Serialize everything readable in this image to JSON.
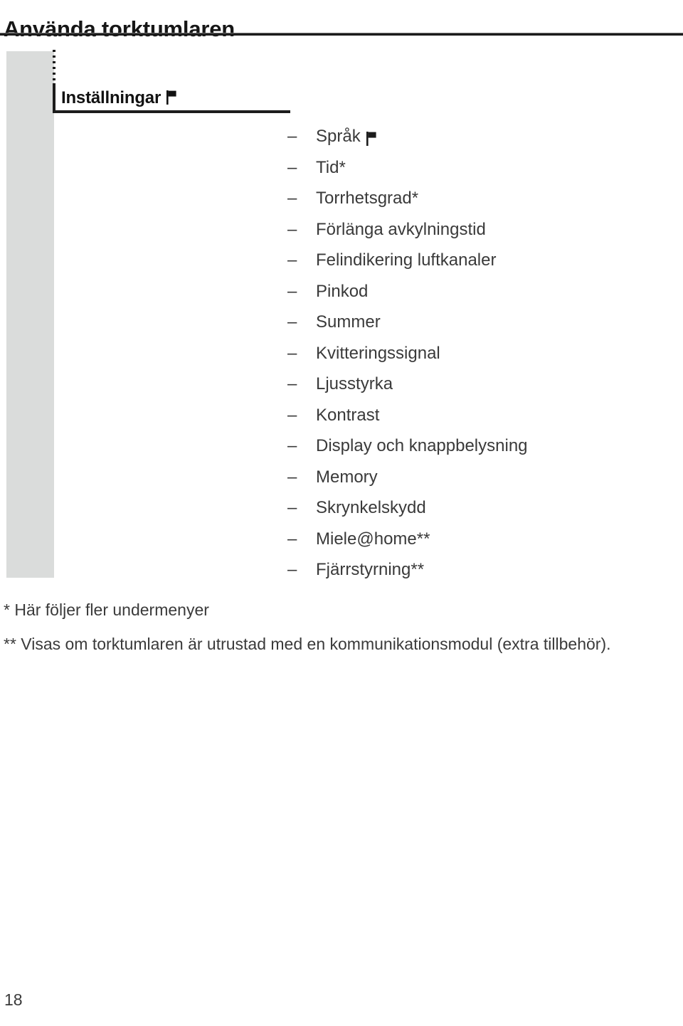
{
  "document": {
    "title": "Använda torktumlaren",
    "page_number": "18"
  },
  "menu": {
    "heading": "Inställningar",
    "heading_icon": "flag-icon",
    "items": [
      {
        "label": "Språk",
        "icon": "flag-icon"
      },
      {
        "label": "Tid*",
        "icon": null
      },
      {
        "label": "Torrhetsgrad*",
        "icon": null
      },
      {
        "label": "Förlänga avkylningstid",
        "icon": null
      },
      {
        "label": "Felindikering luftkanaler",
        "icon": null
      },
      {
        "label": "Pinkod",
        "icon": null
      },
      {
        "label": "Summer",
        "icon": null
      },
      {
        "label": "Kvitteringssignal",
        "icon": null
      },
      {
        "label": "Ljusstyrka",
        "icon": null
      },
      {
        "label": "Kontrast",
        "icon": null
      },
      {
        "label": "Display och knappbelysning",
        "icon": null
      },
      {
        "label": "Memory",
        "icon": null
      },
      {
        "label": "Skrynkelskydd",
        "icon": null
      },
      {
        "label": "Miele@home**",
        "icon": null
      },
      {
        "label": "Fjärrstyrning**",
        "icon": null
      }
    ],
    "bullet_dash": "–"
  },
  "footnotes": [
    "* Här följer fler undermenyer",
    "** Visas om torktumlaren är utrustad med en kommunikationsmodul (extra tillbehör)."
  ],
  "colors": {
    "text": "#3a3a3a",
    "heading": "#111111",
    "rule": "#1c1c1c",
    "side_band": "#dadcdb",
    "page_background": "#ffffff"
  }
}
